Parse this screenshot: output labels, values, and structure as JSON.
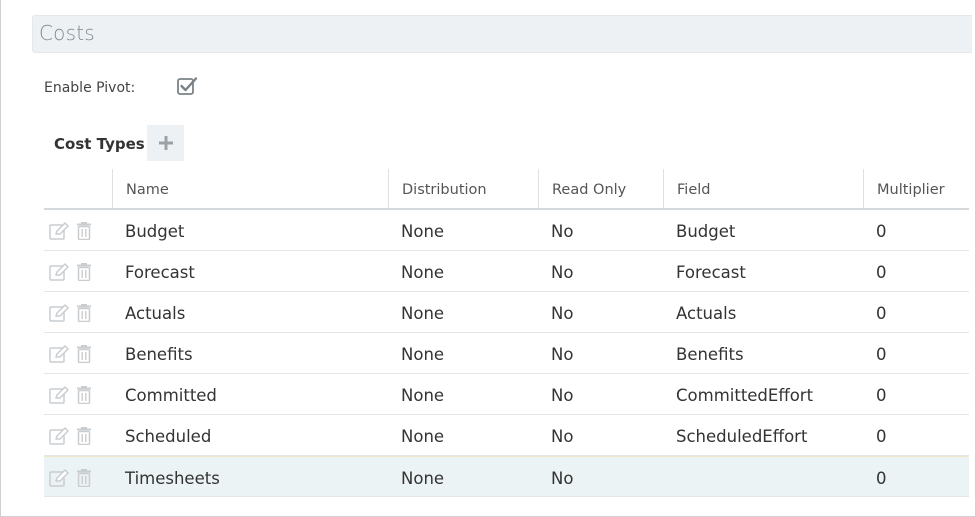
{
  "section": {
    "title": "Costs"
  },
  "pivot": {
    "label": "Enable Pivot:",
    "checked": true,
    "icon": "checkbox-checked-icon"
  },
  "cost_types": {
    "title": "Cost Types",
    "add_icon": "plus-icon",
    "columns": [
      "Name",
      "Distribution",
      "Read Only",
      "Field",
      "Multiplier"
    ],
    "rows": [
      {
        "name": "Budget",
        "distribution": "None",
        "read_only": "No",
        "field": "Budget",
        "multiplier": "0"
      },
      {
        "name": "Forecast",
        "distribution": "None",
        "read_only": "No",
        "field": "Forecast",
        "multiplier": "0"
      },
      {
        "name": "Actuals",
        "distribution": "None",
        "read_only": "No",
        "field": "Actuals",
        "multiplier": "0"
      },
      {
        "name": "Benefits",
        "distribution": "None",
        "read_only": "No",
        "field": "Benefits",
        "multiplier": "0"
      },
      {
        "name": "Committed",
        "distribution": "None",
        "read_only": "No",
        "field": "CommittedEffort",
        "multiplier": "0"
      },
      {
        "name": "Scheduled",
        "distribution": "None",
        "read_only": "No",
        "field": "ScheduledEffort",
        "multiplier": "0"
      },
      {
        "name": "Timesheets",
        "distribution": "None",
        "read_only": "No",
        "field": "",
        "multiplier": "0"
      }
    ],
    "selected_row": 6
  },
  "colors": {
    "header_bg": "#edf1f3",
    "selected_row_bg": "#ecf3f4",
    "icon_gray": "#c9cdd0"
  }
}
